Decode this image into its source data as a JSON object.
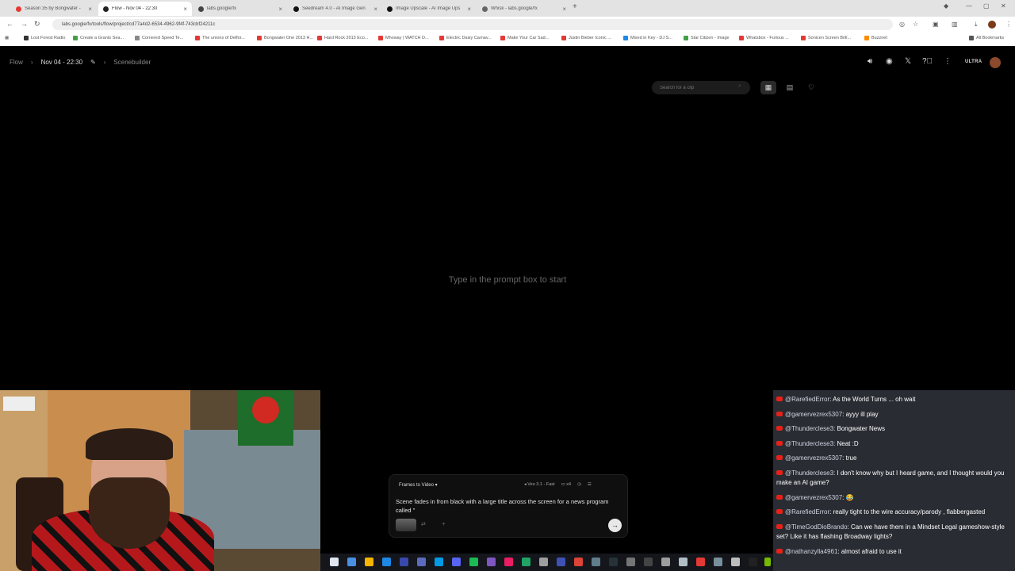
{
  "browser": {
    "tabs": [
      {
        "title": "Season 35 by Bongwater - ",
        "color": "#e53935",
        "active": false
      },
      {
        "title": "Flow - Nov 04 - 22:30",
        "color": "#222222",
        "active": true
      },
      {
        "title": "labs.google/fx",
        "color": "#444444",
        "active": false
      },
      {
        "title": "Seedream 4.0 - AI Image Gen",
        "color": "#111111",
        "active": false
      },
      {
        "title": "Image Upscale - AI Image Ups",
        "color": "#111111",
        "active": false
      },
      {
        "title": "Whisk - labs.google/fx",
        "color": "#666666",
        "active": false
      }
    ],
    "url": "labs.google/fx/tools/flow/project/cd77a4d2-6534-4962-9f4f-743cbf24211c",
    "bookmarks": [
      {
        "label": "Lost Forest Radio",
        "color": "#333333"
      },
      {
        "label": "Create a Grants Sea...",
        "color": "#43a047"
      },
      {
        "label": "Cornered Speed Te...",
        "color": "#888888"
      },
      {
        "label": "The unions of Delfor...",
        "color": "#e53935"
      },
      {
        "label": "Bongwater One 2013 H...",
        "color": "#e53935"
      },
      {
        "label": "Hard Rock 2013 Eco...",
        "color": "#e53935"
      },
      {
        "label": "Mhoway | WATCH D...",
        "color": "#e53935"
      },
      {
        "label": "Electric Daisy Carnav...",
        "color": "#e53935"
      },
      {
        "label": "Make Your Car Sad...",
        "color": "#e53935"
      },
      {
        "label": "Justin Bieber Iconic ...",
        "color": "#e53935"
      },
      {
        "label": "Mixed in Key - DJ S...",
        "color": "#1e88e5"
      },
      {
        "label": "Star Citizen - Image",
        "color": "#43a047"
      },
      {
        "label": "Whatsbox - Furious ...",
        "color": "#e53935"
      },
      {
        "label": "Sonicen Screen Brill...",
        "color": "#e53935"
      },
      {
        "label": "Buzznet",
        "color": "#fb8c00"
      },
      {
        "label": "All Bookmarks",
        "color": "#555555"
      }
    ]
  },
  "app": {
    "breadcrumb": {
      "root": "Flow",
      "project": "Nov 04 - 22:30",
      "section": "Scenebuilder"
    },
    "plan_badge": "ULTRA",
    "search_placeholder": "Search for a clip",
    "empty_message": "Type in the prompt box to start",
    "prompt": {
      "mode": "Frames to Video",
      "model": "Veo 3.1 - Fast",
      "count": "x4",
      "text": "Scene fades in from black with a large title across the screen for a news program called \""
    }
  },
  "chat": {
    "messages": [
      {
        "user": "@RarefiedError",
        "text": "As the World Turns ... oh wait"
      },
      {
        "user": "@gamervezrex5307",
        "text": "ayyy ill play"
      },
      {
        "user": "@Thunderclese3",
        "text": "Bongwater News"
      },
      {
        "user": "@Thunderclese3",
        "text": "Neat :D"
      },
      {
        "user": "@gamervezrex5307",
        "text": "true"
      },
      {
        "user": "@Thunderclese3",
        "text": "I don't know why but I heard game, and I thought would you make an AI game?"
      },
      {
        "user": "@gamervezrex5307",
        "text": "😂"
      },
      {
        "user": "@RarefiedError",
        "text": "really tight to the wire accuracy/parody , flabbergasted"
      },
      {
        "user": "@TimeGodDioBrando",
        "text": "Can we have them in a Mindset Legal gameshow-style set? Like it has flashing Broadway lights?"
      },
      {
        "user": "@nathanzylla4961",
        "text": "almost afraid to use it"
      }
    ]
  },
  "colors": {
    "app_bg": "#000000",
    "chat_bg": "#2a2c33",
    "youtube_red": "#e62117"
  }
}
